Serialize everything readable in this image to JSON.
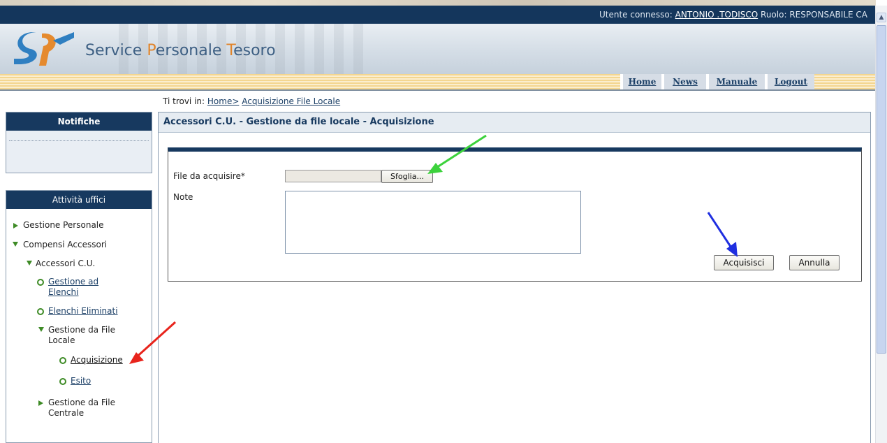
{
  "header": {
    "user_label": "Utente connesso:",
    "user_name": "ANTONIO .TODISCO",
    "role_label": "Ruolo:",
    "role_value": "RESPONSABILE CA",
    "brand_p1": "Service ",
    "brand_o1": "P",
    "brand_p2": "ersonale ",
    "brand_o2": "T",
    "brand_p3": "esoro"
  },
  "nav": {
    "items": [
      "Home",
      "News",
      "Manuale",
      "Logout"
    ]
  },
  "breadcrumb": {
    "prefix": "Ti trovi in:",
    "home": "Home>",
    "current": "Acquisizione File Locale"
  },
  "sidebar": {
    "notifiche_title": "Notifiche",
    "attivita_title": "Attività uffici",
    "tree": {
      "gestione_personale": "Gestione Personale",
      "compensi_accessori": "Compensi Accessori",
      "accessori_cu": "Accessori C.U.",
      "gestione_ad_elenchi_1": "Gestione ad",
      "gestione_ad_elenchi_2": "Elenchi",
      "elenchi_eliminati": "Elenchi Eliminati",
      "gestione_file_locale_1": "Gestione da File",
      "gestione_file_locale_2": "Locale",
      "acquisizione": "Acquisizione",
      "esito": "Esito",
      "gestione_file_centrale_1": "Gestione da File",
      "gestione_file_centrale_2": "Centrale"
    }
  },
  "main": {
    "title": "Accessori C.U. - Gestione da file locale - Acquisizione",
    "file_label": "File da acquisire*",
    "browse_label": "Sfoglia...",
    "note_label": "Note",
    "note_value": "",
    "submit_label": "Acquisisci",
    "cancel_label": "Annulla"
  },
  "annotations": {
    "arrow_colors": {
      "red": "#e8241c",
      "green": "#3cd23c",
      "blue": "#1f2fe0"
    }
  },
  "colors": {
    "dark_navy": "#17395f",
    "panel_header_bg": "#e6ecf2",
    "tree_green": "#3e8b26",
    "nav_stripe": "#f4d690"
  }
}
